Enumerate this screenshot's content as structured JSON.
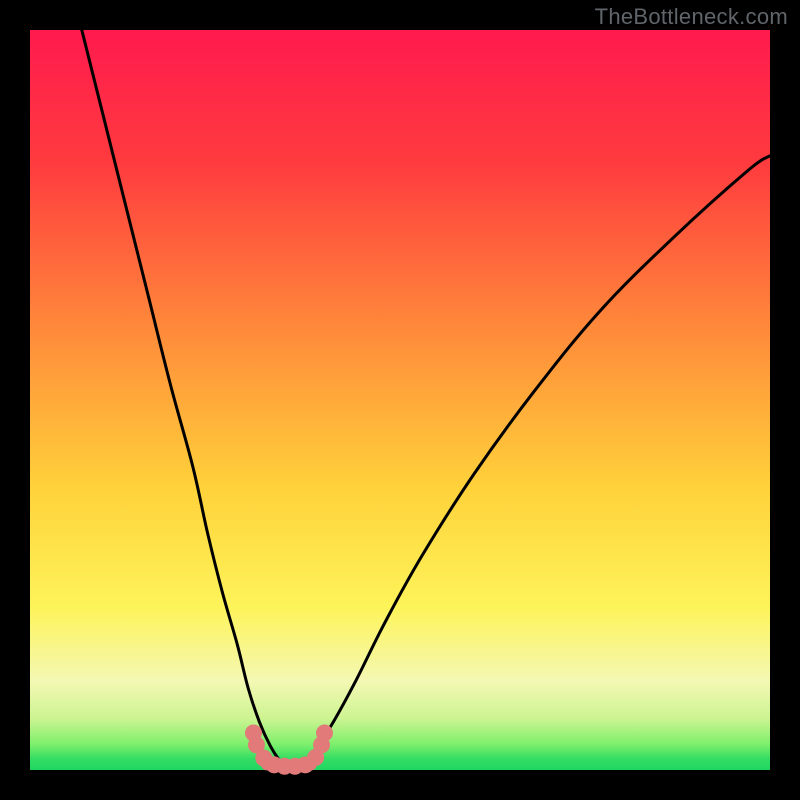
{
  "attribution": "TheBottleneck.com",
  "colors": {
    "bg": "#000000",
    "gradient_top": "#ff1a4e",
    "gradient_mid": "#ffb347",
    "gradient_yellow": "#fdf45a",
    "gradient_pale": "#f4f8b3",
    "gradient_green_light": "#7eef6c",
    "gradient_green": "#1fd661",
    "curve": "#000000",
    "markers_fill": "#e27a7a",
    "markers_stroke": "#b34b4b"
  },
  "chart_data": {
    "type": "line",
    "title": "",
    "xlabel": "",
    "ylabel": "",
    "xlim": [
      0,
      100
    ],
    "ylim": [
      0,
      100
    ],
    "curve_left": {
      "x": [
        7,
        10,
        13,
        16,
        19,
        22,
        24,
        26,
        28,
        29.5,
        31,
        32.5,
        33.8,
        35
      ],
      "y": [
        100,
        88,
        76,
        64,
        52,
        41,
        32,
        24,
        17,
        11,
        6.5,
        3.2,
        1.2,
        0
      ]
    },
    "curve_right": {
      "x": [
        35,
        36,
        37.5,
        39,
        41,
        44,
        48,
        53,
        60,
        68,
        77,
        87,
        97,
        100
      ],
      "y": [
        0,
        0.5,
        1.4,
        3.4,
        6.5,
        12,
        20,
        29,
        40,
        51,
        62,
        72,
        81,
        83
      ]
    },
    "flat_bottom": {
      "x": [
        32.0,
        38.0
      ],
      "y": [
        0.7,
        0.7
      ]
    },
    "markers": [
      {
        "x": 30.2,
        "y": 5.0
      },
      {
        "x": 30.6,
        "y": 3.4
      },
      {
        "x": 31.6,
        "y": 1.6
      },
      {
        "x": 33.0,
        "y": 0.7
      },
      {
        "x": 34.4,
        "y": 0.5
      },
      {
        "x": 35.8,
        "y": 0.5
      },
      {
        "x": 37.2,
        "y": 0.7
      },
      {
        "x": 38.6,
        "y": 1.7
      },
      {
        "x": 39.4,
        "y": 3.4
      },
      {
        "x": 39.8,
        "y": 5.0
      }
    ]
  }
}
